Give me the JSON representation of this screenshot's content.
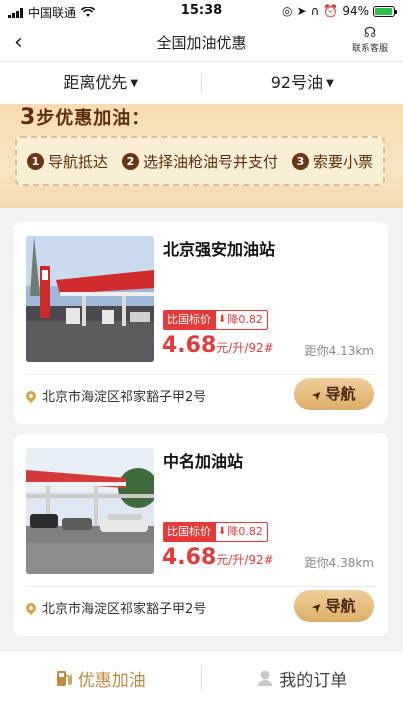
{
  "status_bar": {
    "carrier": "中国联通",
    "time": "15:38",
    "battery": "94%",
    "battery_level": 0.94
  },
  "header": {
    "back_icon": "chevron-left-icon",
    "title": "全国加油优惠",
    "service_label": "联系客服",
    "service_icon": "headset-icon"
  },
  "filters": {
    "sort_label": "距离优先",
    "fuel_label": "92号油"
  },
  "steps_banner": {
    "title_num": "3",
    "title_text": "步优惠加油：",
    "steps": [
      {
        "num": "1",
        "label": "导航抵达"
      },
      {
        "num": "2",
        "label": "选择油枪油号并支付"
      },
      {
        "num": "3",
        "label": "索要小票"
      }
    ]
  },
  "stations": [
    {
      "name": "北京强安加油站",
      "compare_tag": "比国标价",
      "discount": "降0.82",
      "price": "4.68",
      "unit": "元/升/92#",
      "distance": "距你4.13km",
      "address": "北京市海淀区祁家豁子甲2号",
      "nav_label": "导航"
    },
    {
      "name": "中名加油站",
      "compare_tag": "比国标价",
      "discount": "降0.82",
      "price": "4.68",
      "unit": "元/升/92#",
      "distance": "距你4.38km",
      "address": "北京市海淀区祁家豁子甲2号",
      "nav_label": "导航"
    }
  ],
  "tabs": {
    "fuel_tab": "优惠加油",
    "orders_tab": "我的订单"
  },
  "colors": {
    "accent": "#c08a3e",
    "price_red": "#e43a3a",
    "banner_brown": "#5e2e12"
  }
}
